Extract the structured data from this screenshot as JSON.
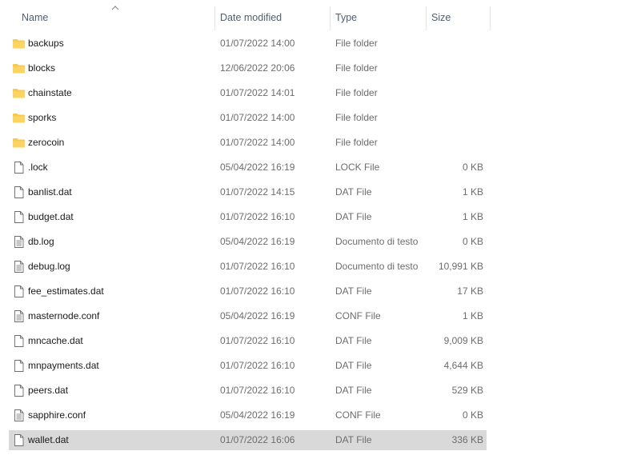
{
  "columns": {
    "name": "Name",
    "date_modified": "Date modified",
    "type": "Type",
    "size": "Size"
  },
  "sort": {
    "column": "name",
    "direction": "ascending"
  },
  "files": [
    {
      "name": "backups",
      "date": "01/07/2022 14:00",
      "type": "File folder",
      "size": "",
      "icon": "folder-icon"
    },
    {
      "name": "blocks",
      "date": "12/06/2022 20:06",
      "type": "File folder",
      "size": "",
      "icon": "folder-icon"
    },
    {
      "name": "chainstate",
      "date": "01/07/2022 14:01",
      "type": "File folder",
      "size": "",
      "icon": "folder-icon"
    },
    {
      "name": "sporks",
      "date": "01/07/2022 14:00",
      "type": "File folder",
      "size": "",
      "icon": "folder-icon"
    },
    {
      "name": "zerocoin",
      "date": "01/07/2022 14:00",
      "type": "File folder",
      "size": "",
      "icon": "folder-icon"
    },
    {
      "name": ".lock",
      "date": "05/04/2022 16:19",
      "type": "LOCK File",
      "size": "0 KB",
      "icon": "file-icon"
    },
    {
      "name": "banlist.dat",
      "date": "01/07/2022 14:15",
      "type": "DAT File",
      "size": "1 KB",
      "icon": "file-icon"
    },
    {
      "name": "budget.dat",
      "date": "01/07/2022 16:10",
      "type": "DAT File",
      "size": "1 KB",
      "icon": "file-icon"
    },
    {
      "name": "db.log",
      "date": "05/04/2022 16:19",
      "type": "Documento di testo",
      "size": "0 KB",
      "icon": "text-file-icon"
    },
    {
      "name": "debug.log",
      "date": "01/07/2022 16:10",
      "type": "Documento di testo",
      "size": "10,991 KB",
      "icon": "text-file-icon"
    },
    {
      "name": "fee_estimates.dat",
      "date": "01/07/2022 16:10",
      "type": "DAT File",
      "size": "17 KB",
      "icon": "file-icon"
    },
    {
      "name": "masternode.conf",
      "date": "05/04/2022 16:19",
      "type": "CONF File",
      "size": "1 KB",
      "icon": "text-file-icon"
    },
    {
      "name": "mncache.dat",
      "date": "01/07/2022 16:10",
      "type": "DAT File",
      "size": "9,009 KB",
      "icon": "file-icon"
    },
    {
      "name": "mnpayments.dat",
      "date": "01/07/2022 16:10",
      "type": "DAT File",
      "size": "4,644 KB",
      "icon": "file-icon"
    },
    {
      "name": "peers.dat",
      "date": "01/07/2022 16:10",
      "type": "DAT File",
      "size": "529 KB",
      "icon": "file-icon"
    },
    {
      "name": "sapphire.conf",
      "date": "05/04/2022 16:19",
      "type": "CONF File",
      "size": "0 KB",
      "icon": "text-file-icon"
    },
    {
      "name": "wallet.dat",
      "date": "01/07/2022 16:06",
      "type": "DAT File",
      "size": "336 KB",
      "icon": "file-icon",
      "selected": true
    }
  ],
  "colors": {
    "header_text": "#4c607a",
    "secondary_text": "#6d6d6d",
    "selection": "#d9d9d9",
    "folder": "#f8c94e"
  }
}
